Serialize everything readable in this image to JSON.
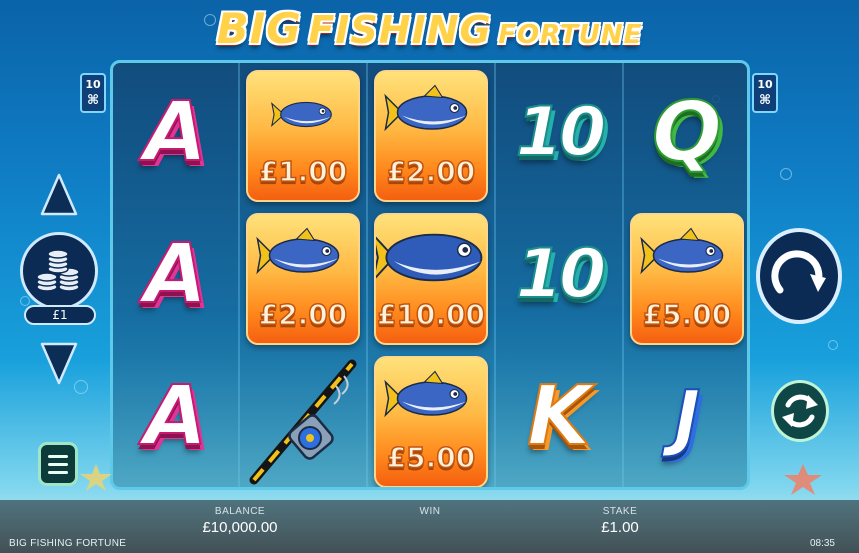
{
  "title": {
    "word1": "BIG",
    "word2": "FISHING",
    "word3": "FORTUNE"
  },
  "lines_badge": {
    "count": "10"
  },
  "stake_selector": {
    "value": "£1"
  },
  "reels": {
    "col1": [
      "A",
      "A",
      "A"
    ],
    "col2": [
      {
        "type": "fish",
        "value": "£1.00"
      },
      {
        "type": "fish",
        "value": "£2.00"
      },
      {
        "type": "rod"
      }
    ],
    "col3": [
      {
        "type": "fish",
        "value": "£2.00"
      },
      {
        "type": "fish",
        "value": "£10.00"
      },
      {
        "type": "fish",
        "value": "£5.00"
      }
    ],
    "col4": [
      "10",
      "10",
      "K"
    ],
    "col5": [
      {
        "type": "letter",
        "value": "Q"
      },
      {
        "type": "fish",
        "value": "£5.00"
      },
      {
        "type": "letter",
        "value": "J"
      }
    ]
  },
  "status_bar": {
    "balance_label": "BALANCE",
    "balance_value": "£10,000.00",
    "win_label": "WIN",
    "win_value": "",
    "stake_label": "STAKE",
    "stake_value": "£1.00",
    "game_name": "BIG FISHING FORTUNE",
    "clock": "08:35"
  },
  "colors": {
    "ocean_top": "#0b63a8",
    "reel_frame": "#5ec9e8",
    "fish_card_top": "#ffe27a",
    "fish_card_bottom": "#f55f10",
    "title_gold": "#ffd24a"
  },
  "icons": [
    "arrow-up-icon",
    "coin-stack-icon",
    "arrow-down-icon",
    "menu-icon",
    "spin-icon",
    "autoplay-icon",
    "fish-icon",
    "fishing-rod-icon",
    "starfish-icon"
  ]
}
